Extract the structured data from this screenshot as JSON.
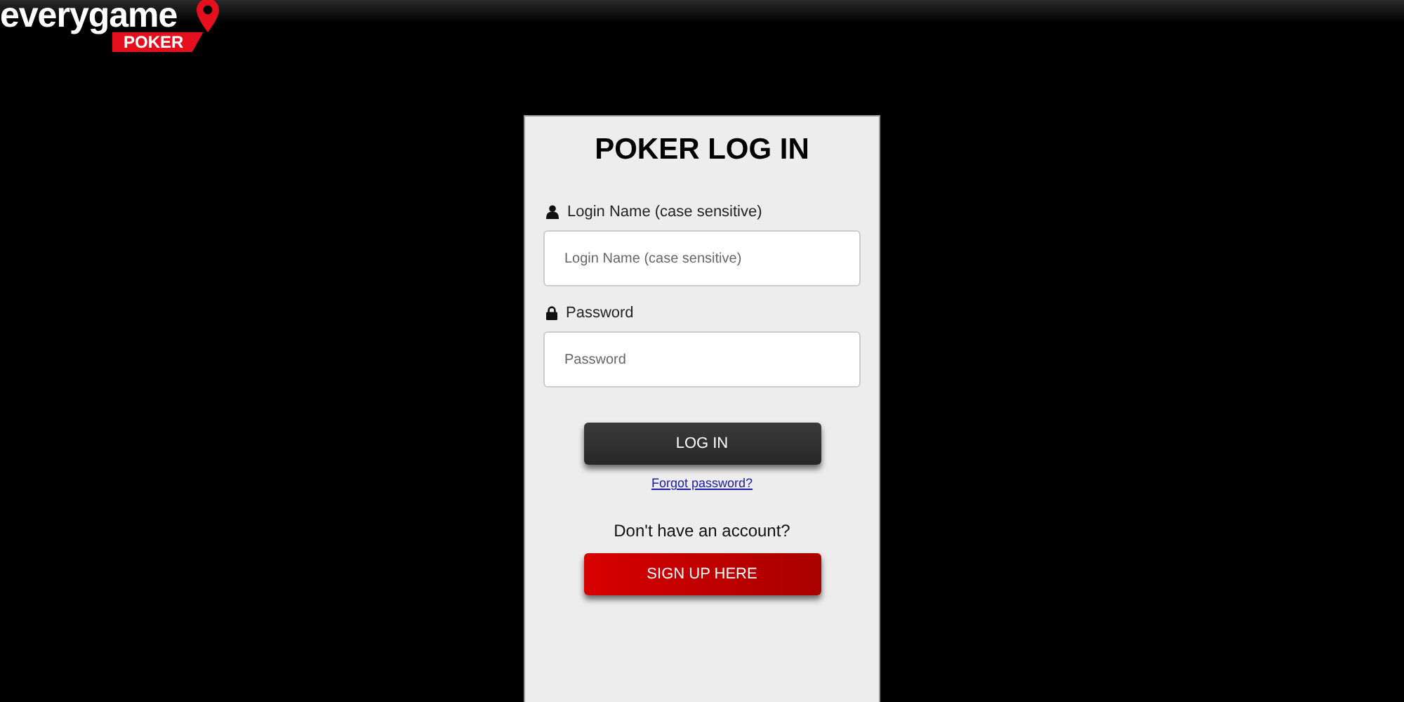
{
  "logo": {
    "name": "everygame",
    "badge": "POKER"
  },
  "login": {
    "title": "POKER LOG IN",
    "fields": [
      {
        "kind": "user",
        "label": "Login Name (case sensitive)",
        "placeholder": "Login Name (case sensitive)"
      },
      {
        "kind": "lock",
        "label": "Password",
        "placeholder": "Password"
      }
    ],
    "login_button": "LOG IN",
    "forgot_link": "Forgot password?",
    "signup_prompt": "Don't have an account?",
    "signup_button": "SIGN UP HERE"
  }
}
